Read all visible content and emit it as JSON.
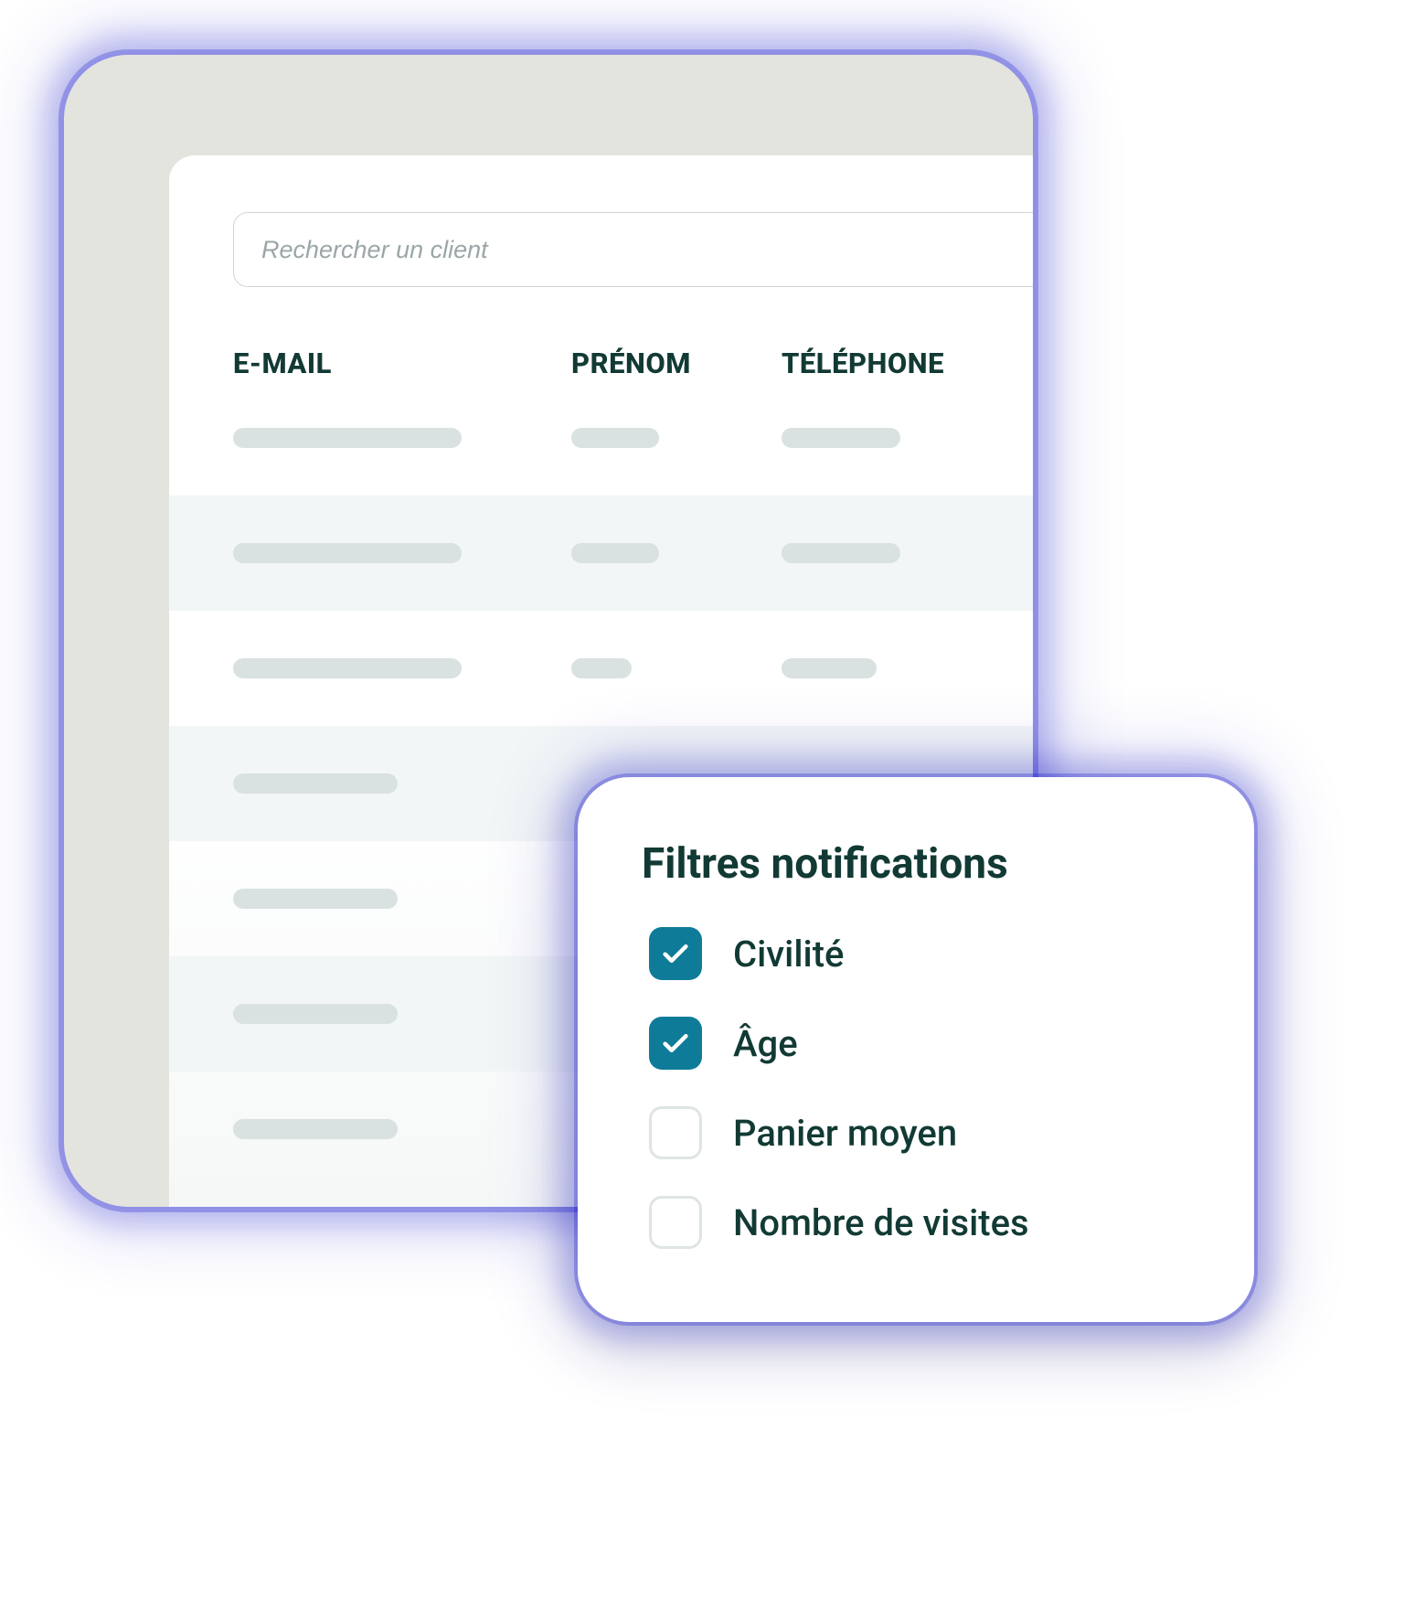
{
  "search": {
    "placeholder": "Rechercher un client"
  },
  "table": {
    "headers": {
      "email": "E-MAIL",
      "prenom": "PRÉNOM",
      "phone": "TÉLÉPHONE"
    }
  },
  "filters": {
    "title": "Filtres notifications",
    "items": [
      {
        "label": "Civilité",
        "checked": true
      },
      {
        "label": "Âge",
        "checked": true
      },
      {
        "label": "Panier moyen",
        "checked": false
      },
      {
        "label": "Nombre de visites",
        "checked": false
      }
    ]
  },
  "colors": {
    "accent": "#0e7c99",
    "text": "#123a34",
    "skeleton": "#d9e1e1",
    "panel": "#e4e4df"
  }
}
